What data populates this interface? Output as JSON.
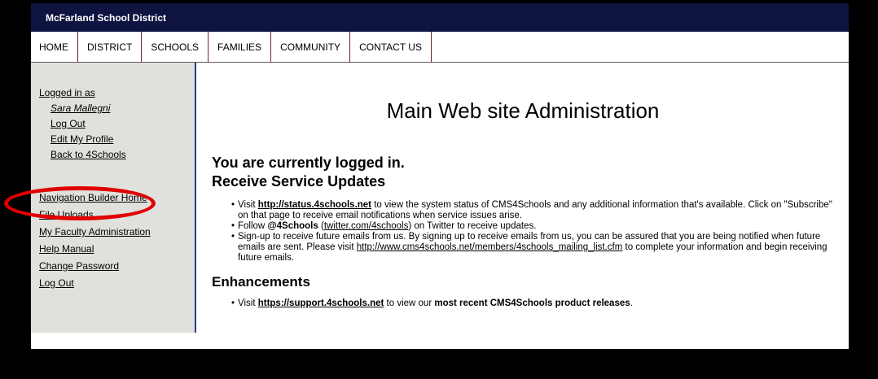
{
  "site": {
    "title": "McFarland School District"
  },
  "nav": {
    "items": [
      {
        "label": "HOME"
      },
      {
        "label": "DISTRICT"
      },
      {
        "label": "SCHOOLS"
      },
      {
        "label": "FAMILIES"
      },
      {
        "label": "COMMUNITY"
      },
      {
        "label": "CONTACT US"
      }
    ]
  },
  "sidebar": {
    "logged_in_label": "Logged in as",
    "user_name": "Sara Mallegni",
    "user_links": [
      {
        "label": "Log Out"
      },
      {
        "label": "Edit My Profile"
      },
      {
        "label": "Back to 4Schools"
      }
    ],
    "admin_links": [
      {
        "label": "Navigation Builder Home"
      },
      {
        "label": "File Uploads"
      },
      {
        "label": "My Faculty Administration"
      },
      {
        "label": "Help Manual"
      },
      {
        "label": "Change Password"
      },
      {
        "label": "Log Out"
      }
    ],
    "highlight_color": "#e00000"
  },
  "main": {
    "heading": "Main Web site Administration",
    "logged_in_heading": "You are currently logged in.",
    "updates_heading": "Receive Service Updates",
    "updates": {
      "b1_prefix": "Visit ",
      "b1_link": "http://status.4schools.net",
      "b1_suffix": " to view the system status of CMS4Schools and any additional information that's available. Click on \"Subscribe\" on that page to receive email notifications when service issues arise.",
      "b2_prefix": "Follow ",
      "b2_handle": "@4Schools",
      "b2_open": " (",
      "b2_link": "twitter.com/4schools",
      "b2_suffix": ") on Twitter to receive updates.",
      "b3_prefix": "Sign-up to receive future emails from us. By signing up to receive emails from us, you can be assured that you are being notified when future emails are sent. Please visit ",
      "b3_link": "http://www.cms4schools.net/members/4schools_mailing_list.cfm",
      "b3_suffix": " to complete your information and begin receiving future emails."
    },
    "enhancements_heading": "Enhancements",
    "enhancements": {
      "prefix": "Visit ",
      "link": "https://support.4schools.net",
      "middle": " to view our ",
      "bold": "most recent CMS4Schools product releases",
      "suffix": "."
    }
  },
  "colors": {
    "topbar": "#0e1340",
    "sidebar_bg": "#e0e0dc",
    "sidebar_border": "#2b3a8c"
  }
}
